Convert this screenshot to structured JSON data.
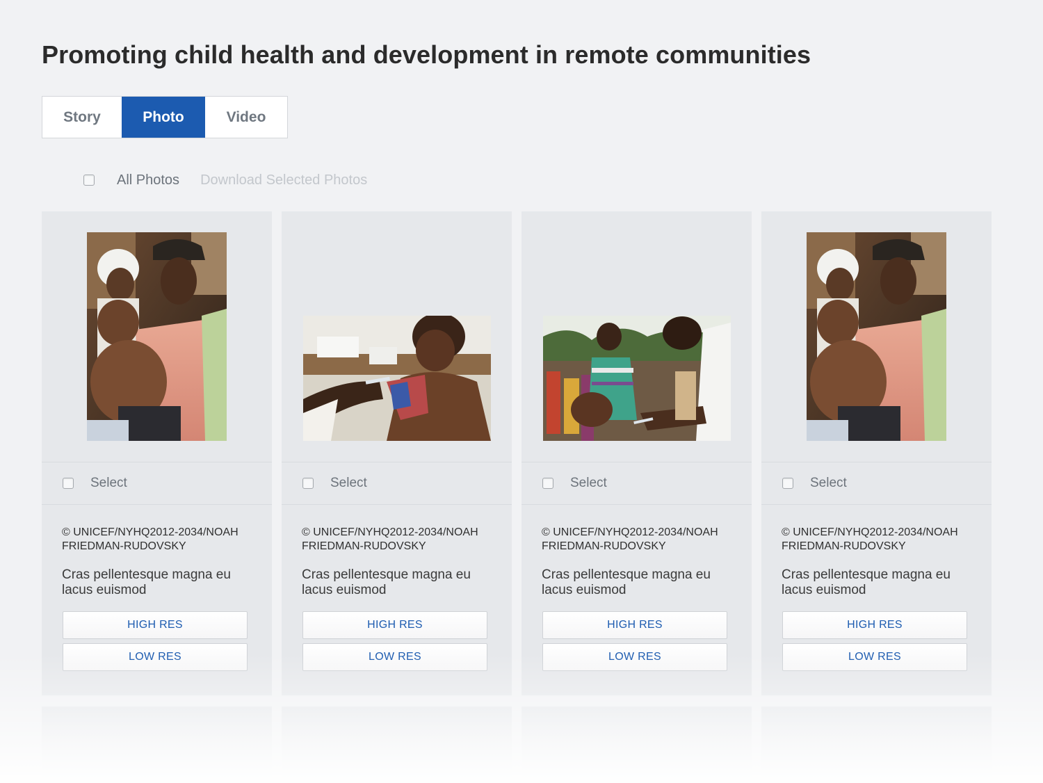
{
  "page": {
    "title": "Promoting child health and development in remote communities"
  },
  "tabs": [
    {
      "label": "Story",
      "active": false
    },
    {
      "label": "Photo",
      "active": true
    },
    {
      "label": "Video",
      "active": false
    }
  ],
  "toolbar": {
    "all_photos_label": "All Photos",
    "download_selected_label": "Download Selected Photos"
  },
  "colors": {
    "accent": "#1c5bb0",
    "background": "#f1f2f4",
    "card": "#e6e8eb"
  },
  "cards": [
    {
      "photo_orientation": "portrait",
      "select_label": "Select",
      "credit": "© UNICEF/NYHQ2012-2034/NOAH FRIEDMAN-RUDOVSKY",
      "caption": "Cras pellentesque magna eu lacus euismod",
      "high_res_label": "HIGH RES",
      "low_res_label": "LOW RES"
    },
    {
      "photo_orientation": "landscape",
      "select_label": "Select",
      "credit": "© UNICEF/NYHQ2012-2034/NOAH FRIEDMAN-RUDOVSKY",
      "caption": "Cras pellentesque magna eu lacus euismod",
      "high_res_label": "HIGH RES",
      "low_res_label": "LOW RES"
    },
    {
      "photo_orientation": "landscape",
      "select_label": "Select",
      "credit": "© UNICEF/NYHQ2012-2034/NOAH FRIEDMAN-RUDOVSKY",
      "caption": "Cras pellentesque magna eu lacus euismod",
      "high_res_label": "HIGH RES",
      "low_res_label": "LOW RES"
    },
    {
      "photo_orientation": "portrait",
      "select_label": "Select",
      "credit": "© UNICEF/NYHQ2012-2034/NOAH FRIEDMAN-RUDOVSKY",
      "caption": "Cras pellentesque magna eu lacus euismod",
      "high_res_label": "HIGH RES",
      "low_res_label": "LOW RES"
    }
  ]
}
